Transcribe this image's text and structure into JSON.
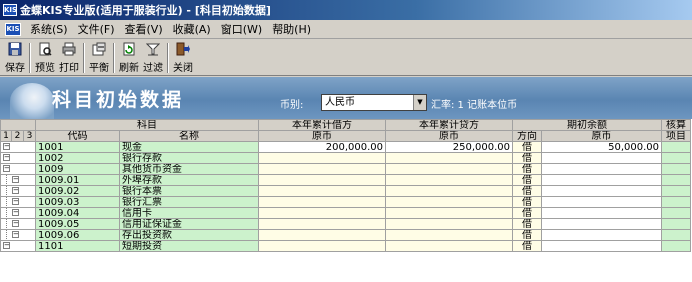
{
  "window": {
    "title": "金蝶KIS专业版(适用于服装行业) - [科目初始数据]",
    "icon_text": "KIS"
  },
  "menu": {
    "logo_text": "KIS",
    "items": [
      "系统(S)",
      "文件(F)",
      "查看(V)",
      "收藏(A)",
      "窗口(W)",
      "帮助(H)"
    ]
  },
  "toolbar": {
    "buttons": [
      {
        "label": "保存",
        "icon": "save-icon"
      },
      {
        "label": "预览",
        "icon": "preview-icon"
      },
      {
        "label": "打印",
        "icon": "print-icon"
      },
      {
        "label": "平衡",
        "icon": "balance-icon"
      },
      {
        "label": "刷新",
        "icon": "refresh-icon"
      },
      {
        "label": "过滤",
        "icon": "filter-icon"
      },
      {
        "label": "关闭",
        "icon": "close-icon"
      }
    ]
  },
  "banner": {
    "title": "科目初始数据",
    "currency_label": "币别:",
    "currency_value": "人民币",
    "rate_text": "汇率: 1  记账本位币"
  },
  "grid": {
    "levels": [
      "1",
      "2",
      "3"
    ],
    "header1": {
      "subject": "科目",
      "debit": "本年累计借方",
      "credit": "本年累计贷方",
      "opening": "期初余额",
      "check": "核算"
    },
    "header2": {
      "code": "代码",
      "name": "名称",
      "debit_orig": "原币",
      "credit_orig": "原币",
      "direction": "方向",
      "opening_orig": "原币",
      "item": "项目"
    },
    "rows": [
      {
        "code": "1001",
        "name": "现金",
        "debit": "200,000.00",
        "credit": "250,000.00",
        "dir": "借",
        "opening": "50,000.00",
        "indent": 0
      },
      {
        "code": "1002",
        "name": "银行存款",
        "debit": "",
        "credit": "",
        "dir": "借",
        "opening": "",
        "indent": 0
      },
      {
        "code": "1009",
        "name": "其他货币资金",
        "debit": "",
        "credit": "",
        "dir": "借",
        "opening": "",
        "indent": 0
      },
      {
        "code": "1009.01",
        "name": "外埠存款",
        "debit": "",
        "credit": "",
        "dir": "借",
        "opening": "",
        "indent": 1
      },
      {
        "code": "1009.02",
        "name": "银行本票",
        "debit": "",
        "credit": "",
        "dir": "借",
        "opening": "",
        "indent": 1
      },
      {
        "code": "1009.03",
        "name": "银行汇票",
        "debit": "",
        "credit": "",
        "dir": "借",
        "opening": "",
        "indent": 1
      },
      {
        "code": "1009.04",
        "name": "信用卡",
        "debit": "",
        "credit": "",
        "dir": "借",
        "opening": "",
        "indent": 1
      },
      {
        "code": "1009.05",
        "name": "信用证保证金",
        "debit": "",
        "credit": "",
        "dir": "借",
        "opening": "",
        "indent": 1
      },
      {
        "code": "1009.06",
        "name": "存出投资款",
        "debit": "",
        "credit": "",
        "dir": "借",
        "opening": "",
        "indent": 1
      },
      {
        "code": "1101",
        "name": "短期投资",
        "debit": "",
        "credit": "",
        "dir": "借",
        "opening": "",
        "indent": 0
      }
    ]
  }
}
